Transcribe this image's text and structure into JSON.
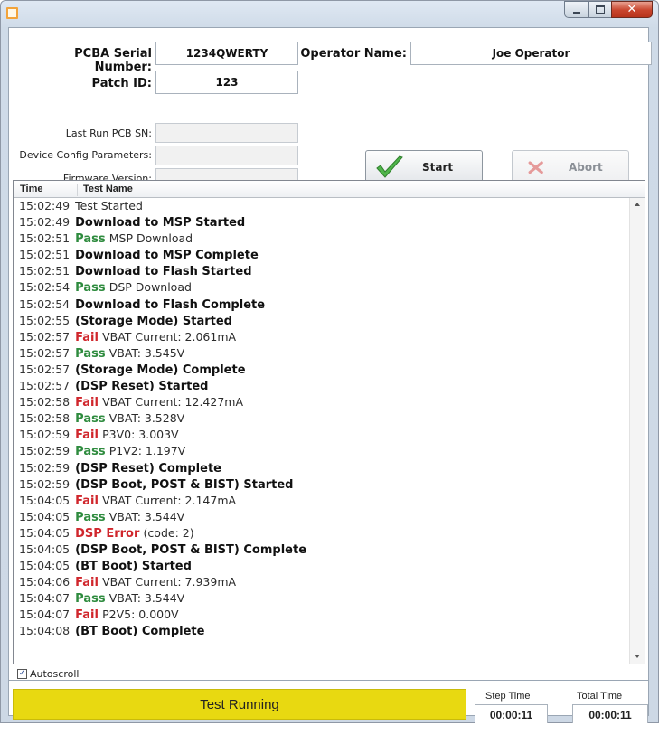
{
  "form": {
    "serial_label": "PCBA Serial Number:",
    "serial_value": "1234QWERTY",
    "operator_label": "Operator Name:",
    "operator_value": "Joe Operator",
    "patch_label": "Patch ID:",
    "patch_value": "123",
    "last_run_label": "Last Run PCB SN:",
    "last_run_value": "",
    "config_label": "Device Config Parameters:",
    "config_value": "",
    "firmware_label": "Firmware Version:",
    "firmware_value": ""
  },
  "buttons": {
    "start_label": "Start",
    "abort_label": "Abort"
  },
  "log": {
    "col_time": "Time",
    "col_name": "Test Name",
    "rows": [
      {
        "time": "15:02:49",
        "status": "",
        "message": "Test Started",
        "style": "light"
      },
      {
        "time": "15:02:49",
        "status": "",
        "message": "Download to MSP Started",
        "style": "heavy"
      },
      {
        "time": "15:02:51",
        "status": "Pass",
        "message": "MSP Download",
        "style": "light"
      },
      {
        "time": "15:02:51",
        "status": "",
        "message": "Download to MSP Complete",
        "style": "heavy"
      },
      {
        "time": "15:02:51",
        "status": "",
        "message": "Download to Flash Started",
        "style": "heavy"
      },
      {
        "time": "15:02:54",
        "status": "Pass",
        "message": "DSP Download",
        "style": "light"
      },
      {
        "time": "15:02:54",
        "status": "",
        "message": "Download to Flash Complete",
        "style": "heavy"
      },
      {
        "time": "15:02:55",
        "status": "",
        "message": "(Storage Mode) Started",
        "style": "heavy"
      },
      {
        "time": "15:02:57",
        "status": "Fail",
        "message": "VBAT Current: 2.061mA",
        "style": "light"
      },
      {
        "time": "15:02:57",
        "status": "Pass",
        "message": "VBAT: 3.545V",
        "style": "light"
      },
      {
        "time": "15:02:57",
        "status": "",
        "message": "(Storage Mode) Complete",
        "style": "heavy"
      },
      {
        "time": "15:02:57",
        "status": "",
        "message": "(DSP Reset) Started",
        "style": "heavy"
      },
      {
        "time": "15:02:58",
        "status": "Fail",
        "message": "VBAT Current: 12.427mA",
        "style": "light"
      },
      {
        "time": "15:02:58",
        "status": "Pass",
        "message": "VBAT: 3.528V",
        "style": "light"
      },
      {
        "time": "15:02:59",
        "status": "Fail",
        "message": "P3V0: 3.003V",
        "style": "light"
      },
      {
        "time": "15:02:59",
        "status": "Pass",
        "message": "P1V2: 1.197V",
        "style": "light"
      },
      {
        "time": "15:02:59",
        "status": "",
        "message": "(DSP Reset) Complete",
        "style": "heavy"
      },
      {
        "time": "15:02:59",
        "status": "",
        "message": "(DSP Boot, POST & BIST) Started",
        "style": "heavy"
      },
      {
        "time": "15:04:05",
        "status": "Fail",
        "message": "VBAT Current: 2.147mA",
        "style": "light"
      },
      {
        "time": "15:04:05",
        "status": "Pass",
        "message": "VBAT: 3.544V",
        "style": "light"
      },
      {
        "time": "15:04:05",
        "status": "DSP Error",
        "message": "(code: 2)",
        "style": "light"
      },
      {
        "time": "15:04:05",
        "status": "",
        "message": "(DSP Boot, POST & BIST) Complete",
        "style": "heavy"
      },
      {
        "time": "15:04:05",
        "status": "",
        "message": "(BT Boot) Started",
        "style": "heavy"
      },
      {
        "time": "15:04:06",
        "status": "Fail",
        "message": "VBAT Current: 7.939mA",
        "style": "light"
      },
      {
        "time": "15:04:07",
        "status": "Pass",
        "message": "VBAT: 3.544V",
        "style": "light"
      },
      {
        "time": "15:04:07",
        "status": "Fail",
        "message": "P2V5: 0.000V",
        "style": "light"
      },
      {
        "time": "15:04:08",
        "status": "",
        "message": "(BT Boot) Complete",
        "style": "heavy"
      }
    ]
  },
  "autoscroll": {
    "label": "Autoscroll",
    "checked": true
  },
  "status": {
    "text": "Test Running",
    "color": "#e8d911",
    "step_label": "Step Time",
    "step_value": "00:00:11",
    "total_label": "Total Time",
    "total_value": "00:00:11"
  },
  "colors": {
    "pass": "#2e8b3e",
    "fail": "#d0262c"
  },
  "icons": {
    "start": "checkmark-icon",
    "abort": "x-icon",
    "window": "app-icon"
  }
}
